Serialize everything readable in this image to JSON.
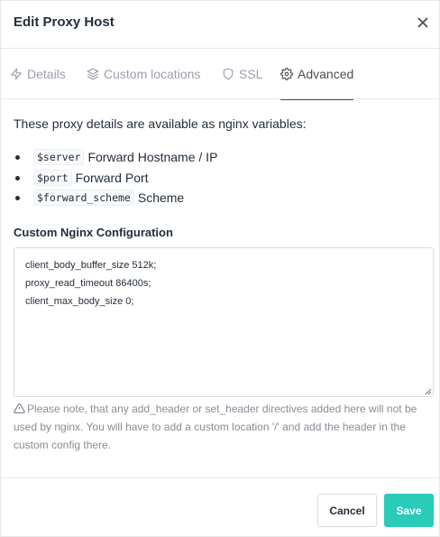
{
  "modal": {
    "title": "Edit Proxy Host",
    "close_icon": "close-icon"
  },
  "tabs": [
    {
      "label": "Details",
      "icon": "lightning-icon",
      "active": false
    },
    {
      "label": "Custom locations",
      "icon": "layers-icon",
      "active": false
    },
    {
      "label": "SSL",
      "icon": "shield-icon",
      "active": false
    },
    {
      "label": "Advanced",
      "icon": "gear-icon",
      "active": true
    }
  ],
  "advanced": {
    "intro": "These proxy details are available as nginx variables:",
    "variables": [
      {
        "code": "$server",
        "desc": "Forward Hostname / IP"
      },
      {
        "code": "$port",
        "desc": "Forward Port"
      },
      {
        "code": "$forward_scheme",
        "desc": "Scheme"
      }
    ],
    "config_label": "Custom Nginx Configuration",
    "config_value": "client_body_buffer_size 512k;\nproxy_read_timeout 86400s;\nclient_max_body_size 0;",
    "note": "Please note, that any add_header or set_header directives added here will not be used by nginx. You will have to add a custom location '/' and add the header in the custom config there."
  },
  "footer": {
    "cancel_label": "Cancel",
    "save_label": "Save"
  },
  "colors": {
    "accent": "#2bcbba",
    "text": "#232e3c",
    "muted": "#9aa0ac"
  }
}
